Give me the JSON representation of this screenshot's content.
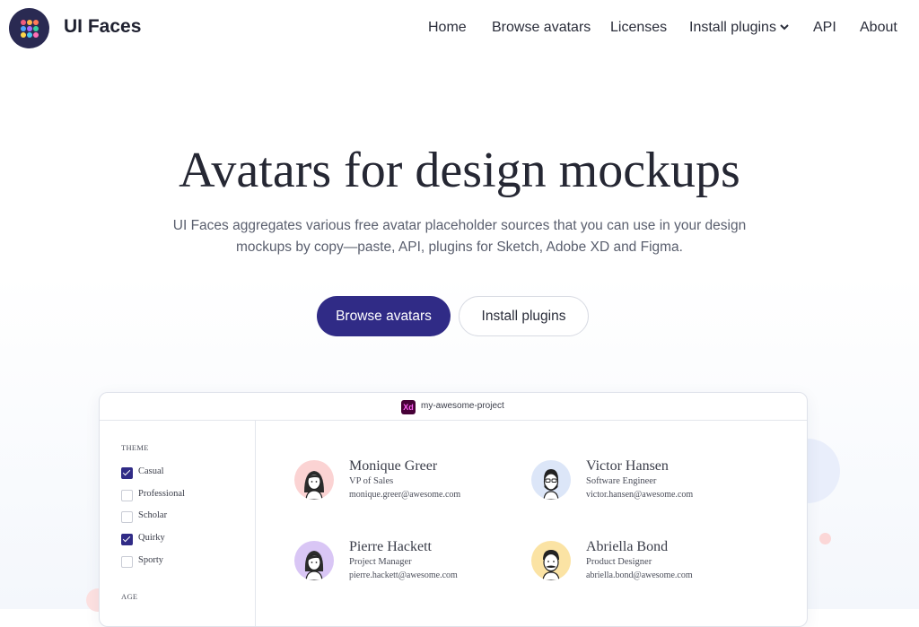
{
  "brand": {
    "name": "UI Faces",
    "logo_icon": "grid-dots-icon"
  },
  "nav": {
    "items": [
      {
        "label": "Home"
      },
      {
        "label": "Browse avatars"
      },
      {
        "label": "Licenses"
      },
      {
        "label": "Install plugins",
        "icon": "chevron-down-icon"
      },
      {
        "label": "API"
      },
      {
        "label": "About"
      }
    ]
  },
  "hero": {
    "title": "Avatars for design mockups",
    "subtitle_line1": "UI Faces aggregates various free avatar placeholder sources that you can use in your design",
    "subtitle_line2": "mockups by copy—paste, API, plugins for Sketch, Adobe XD and Figma.",
    "primary_button": "Browse avatars",
    "secondary_button": "Install plugins"
  },
  "mockup": {
    "window_title": "my-awesome-project",
    "app_icon_label": "Xd",
    "sidebar": {
      "theme_heading": "THEME",
      "theme_options": [
        {
          "label": "Casual",
          "checked": true
        },
        {
          "label": "Professional",
          "checked": false
        },
        {
          "label": "Scholar",
          "checked": false
        },
        {
          "label": "Quirky",
          "checked": true
        },
        {
          "label": "Sporty",
          "checked": false
        }
      ],
      "age_heading": "AGE"
    },
    "contacts": [
      {
        "name": "Monique Greer",
        "role": "VP of Sales",
        "email": "monique.greer@awesome.com",
        "avatar_bg": "#fbd3d3"
      },
      {
        "name": "Victor Hansen",
        "role": "Software Engineer",
        "email": "victor.hansen@awesome.com",
        "avatar_bg": "#dce6f8"
      },
      {
        "name": "Pierre Hackett",
        "role": "Project Manager",
        "email": "pierre.hackett@awesome.com",
        "avatar_bg": "#d9c6f5"
      },
      {
        "name": "Abriella Bond",
        "role": "Product Designer",
        "email": "abriella.bond@awesome.com",
        "avatar_bg": "#fbe3a4"
      }
    ]
  },
  "colors": {
    "primary": "#302b86",
    "text_dark": "#252733",
    "text_muted": "#5a5f6e"
  }
}
